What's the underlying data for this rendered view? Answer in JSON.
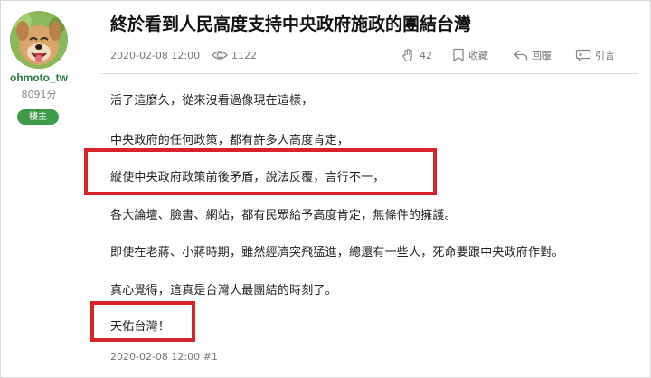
{
  "author": {
    "username": "ohmoto_tw",
    "points": "8091分",
    "badge": "樓主"
  },
  "post": {
    "title": "終於看到人民高度支持中央政府施政的團結台灣",
    "date": "2020-02-08 12:00",
    "views": "1122",
    "likes": "42",
    "favorite_label": "收藏",
    "reply_label": "回覆",
    "quote_label": "引言",
    "paragraphs": [
      "活了這麼久，從來沒看過像現在這樣，",
      "中央政府的任何政策，都有許多人高度肯定，",
      "縱使中央政府政策前後矛盾，說法反覆，言行不一，",
      "各大論壇、臉書、網站，都有民眾給予高度肯定，無條件的擁護。",
      "即使在老蔣、小蔣時期，雖然經濟突飛猛進，總還有一些人，死命要跟中央政府作對。",
      "真心覺得，這真是台灣人最團結的時刻了。",
      "天佑台灣！"
    ],
    "footer": "2020-02-08 12:00 #1"
  },
  "colors": {
    "highlight": "#d9232b",
    "badge_bg": "#3f9b49",
    "username": "#2f7a3f"
  },
  "icons": {
    "views": "eye-icon",
    "likes": "clap-icon",
    "favorite": "bookmark-icon",
    "reply": "reply-icon",
    "quote": "quote-icon"
  }
}
